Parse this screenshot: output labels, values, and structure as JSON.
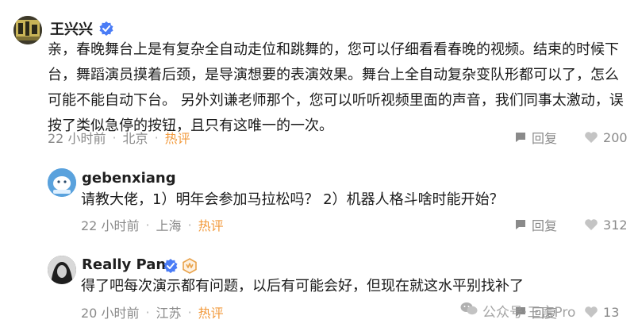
{
  "comments": [
    {
      "username": "王兴兴",
      "content": "亲，春晚舞台上是有复杂全自动走位和跳舞的，您可以仔细看看春晚的视频。结束的时候下台，舞蹈演员摸着后颈，是导演想要的表演效果。舞台上全自动复杂变队形都可以了，怎么可能不能自动下台。 另外刘谦老师那个，您可以听听视频里面的声音，我们同事太激动，误按了类似急停的按钮，且只有这唯一的一次。",
      "time": "22 小时前",
      "location": "北京",
      "tag": "热评",
      "reply_label": "回复",
      "likes": "200"
    },
    {
      "username": "gebenxiang",
      "content": "请教大佬，1）明年会参加马拉松吗？ 2）机器人格斗啥时能开始？",
      "time": "22 小时前",
      "location": "上海",
      "tag": "热评",
      "reply_label": "回复",
      "likes": "312"
    },
    {
      "username": "Really Pan",
      "content": "得了吧每次演示都有问题，以后有可能会好，但现在就这水平别找补了",
      "time": "20 小时前",
      "location": "江苏",
      "tag": "热评",
      "reply_label": "回复",
      "likes": "13"
    }
  ],
  "watermark": "公众号·三言Pro",
  "colors": {
    "hot": "#f29a3c",
    "meta": "#8a8a8a",
    "verified": "#4a7cf6",
    "level": "#e9a24a"
  }
}
